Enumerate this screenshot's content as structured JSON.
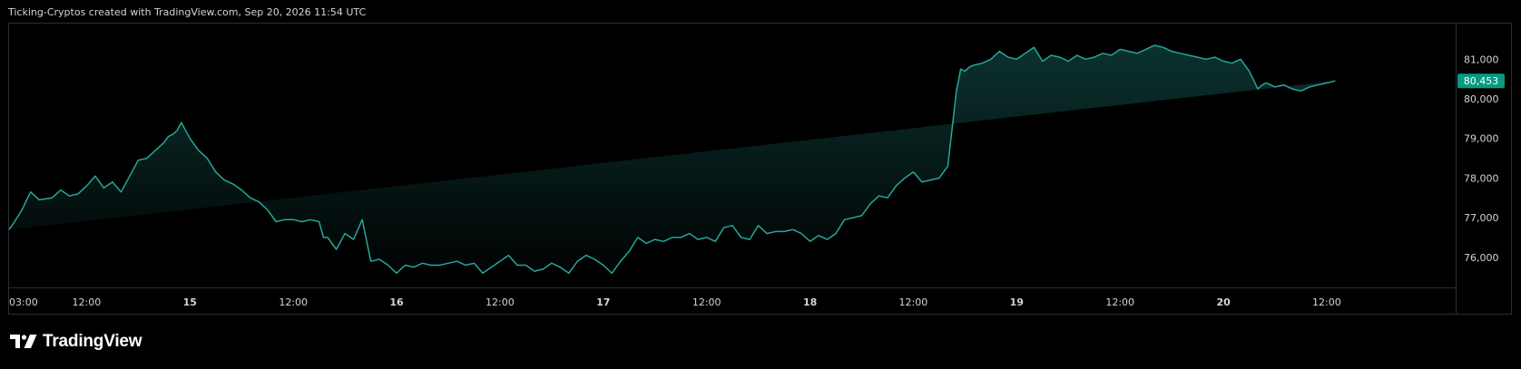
{
  "header": {
    "attribution": "Ticking-Cryptos created with TradingView.com, Sep 20, 2026 11:54 UTC"
  },
  "branding": {
    "logo_text": "TradingView",
    "logo_icon": "tradingview-logo-icon"
  },
  "colors": {
    "background": "#000000",
    "line": "#26a69a",
    "price_label_bg": "#089981",
    "text": "#d1d4dc",
    "frame": "#2a2e39"
  },
  "chart_data": {
    "type": "area",
    "title": "",
    "xlabel": "",
    "ylabel": "",
    "x_tick_labels": [
      "03:00",
      "12:00",
      "15",
      "12:00",
      "16",
      "12:00",
      "17",
      "12:00",
      "18",
      "12:00",
      "19",
      "12:00",
      "20",
      "12:00"
    ],
    "x_tick_hours": [
      3,
      12,
      24,
      36,
      48,
      60,
      72,
      84,
      96,
      108,
      120,
      132,
      144,
      156
    ],
    "y_tick_labels": [
      "76,000",
      "77,000",
      "78,000",
      "79,000",
      "80,000",
      "81,000"
    ],
    "y_tick_values": [
      76000,
      77000,
      78000,
      79000,
      80000,
      81000
    ],
    "ylim": [
      75400,
      81900
    ],
    "xlim_hours": [
      3,
      159.8
    ],
    "grid": false,
    "last_price_label": "80,453",
    "last_price": 80453,
    "series": [
      {
        "x_hours": [
          3,
          3.5,
          4.5,
          5.5,
          6.5,
          8,
          9,
          10,
          11,
          12,
          13,
          14,
          15,
          16,
          17,
          18,
          19,
          20,
          20.5,
          21,
          21.5,
          22,
          22.5,
          23,
          24,
          25,
          26,
          27,
          28,
          29,
          30,
          31,
          32,
          33,
          34,
          35,
          36,
          37,
          38,
          39,
          39.5,
          40,
          41,
          42,
          43,
          44,
          45,
          46,
          47,
          48,
          49,
          50,
          51,
          52,
          53,
          54,
          55,
          56,
          57,
          58,
          59,
          60,
          61,
          62,
          63,
          64,
          65,
          66,
          67,
          68,
          69,
          70,
          71,
          72,
          73,
          74,
          75,
          76,
          77,
          78,
          79,
          80,
          81,
          82,
          83,
          84,
          85,
          86,
          87,
          88,
          89,
          90,
          91,
          92,
          93,
          94,
          95,
          96,
          97,
          98,
          99,
          100,
          101,
          102,
          103,
          104,
          105,
          106,
          107,
          108,
          109,
          110,
          111,
          112,
          113,
          113.5,
          114,
          114.5,
          115,
          116,
          117,
          118,
          119,
          120,
          121,
          122,
          123,
          124,
          125,
          126,
          127,
          128,
          129,
          130,
          131,
          132,
          133,
          134,
          135,
          136,
          137,
          138,
          139,
          140,
          141,
          142,
          143,
          144,
          145,
          146,
          147,
          148,
          148.5,
          149,
          150,
          151,
          152,
          153,
          154,
          155,
          156,
          157,
          158,
          159.8
        ],
        "values": [
          76700,
          76850,
          77200,
          77650,
          77450,
          77500,
          77700,
          77550,
          77600,
          77800,
          78050,
          77750,
          77900,
          77650,
          78050,
          78450,
          78500,
          78700,
          78800,
          78900,
          79050,
          79100,
          79200,
          79400,
          79000,
          78700,
          78500,
          78150,
          77950,
          77850,
          77700,
          77500,
          77400,
          77200,
          76900,
          76950,
          76950,
          76900,
          76950,
          76900,
          76500,
          76500,
          76200,
          76600,
          76450,
          76950,
          75900,
          75950,
          75800,
          75600,
          75800,
          75750,
          75850,
          75800,
          75800,
          75850,
          75900,
          75800,
          75850,
          75600,
          75750,
          75900,
          76050,
          75800,
          75800,
          75650,
          75700,
          75850,
          75750,
          75600,
          75900,
          76050,
          75950,
          75800,
          75600,
          75900,
          76150,
          76500,
          76350,
          76450,
          76400,
          76500,
          76500,
          76600,
          76450,
          76500,
          76400,
          76750,
          76800,
          76500,
          76450,
          76800,
          76600,
          76650,
          76650,
          76700,
          76600,
          76400,
          76550,
          76450,
          76600,
          76950,
          77000,
          77050,
          77350,
          77550,
          77500,
          77800,
          78000,
          78150,
          77900,
          77950,
          78000,
          78300,
          80200,
          80750,
          80700,
          80800,
          80850,
          80900,
          81000,
          81200,
          81050,
          81000,
          81150,
          81300,
          80950,
          81100,
          81050,
          80950,
          81100,
          81000,
          81050,
          81150,
          81100,
          81250,
          81200,
          81150,
          81250,
          81350,
          81300,
          81200,
          81150,
          81100,
          81050,
          81000,
          81050,
          80950,
          80900,
          81000,
          80700,
          80250,
          80350,
          80400,
          80300,
          80350,
          80250,
          80200,
          80300,
          80350,
          80400,
          80453
        ]
      }
    ]
  }
}
